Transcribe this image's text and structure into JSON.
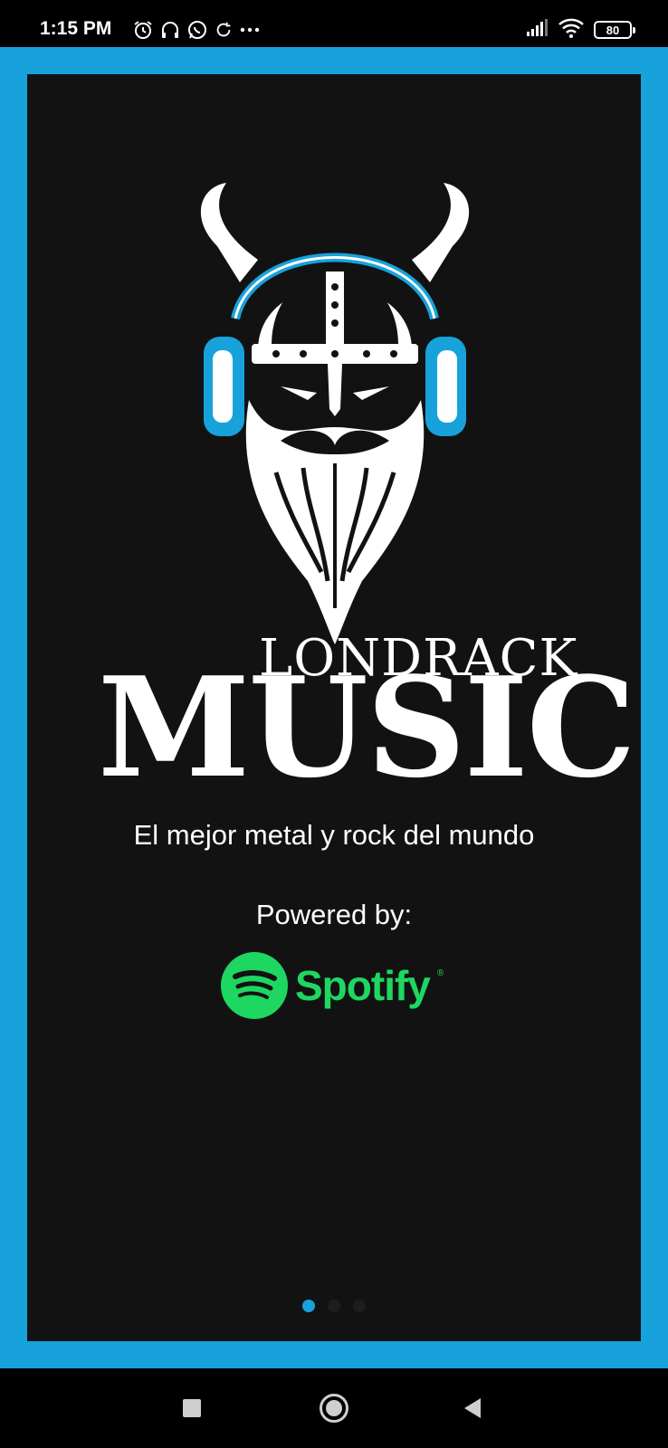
{
  "status_bar": {
    "time": "1:15 PM",
    "battery": "80",
    "icons": [
      "alarm-icon",
      "headphones-icon",
      "whatsapp-icon",
      "sync-icon",
      "more-dots-icon",
      "signal-icon",
      "wifi-icon",
      "battery-icon"
    ]
  },
  "splash": {
    "brand_line1": "LONDRACK",
    "brand_line2": "MUSIC",
    "tagline": "El mejor metal y rock del mundo",
    "powered_by": "Powered by:",
    "provider": "Spotify",
    "logo_icon": "viking-headphones-logo"
  },
  "pager": {
    "pages": 3,
    "current": 1
  },
  "colors": {
    "frame": "#17a2db",
    "card": "#121213",
    "spotify_green": "#1ed760",
    "dot_active": "#17a2db",
    "dot_inactive": "#1d1d1f"
  },
  "navbar": {
    "icons": [
      "recents-icon",
      "home-icon",
      "back-icon"
    ]
  }
}
